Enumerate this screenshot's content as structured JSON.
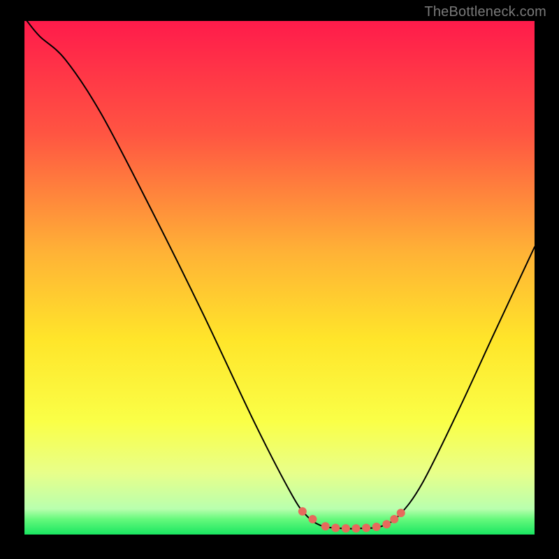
{
  "watermark": "TheBottleneck.com",
  "chart_data": {
    "type": "line",
    "title": "",
    "xlabel": "",
    "ylabel": "",
    "xlim": [
      0,
      100
    ],
    "ylim": [
      0,
      100
    ],
    "legend": false,
    "grid": false,
    "gradient_stops": [
      {
        "offset": 0.0,
        "color": "#ff1b4b"
      },
      {
        "offset": 0.22,
        "color": "#ff5542"
      },
      {
        "offset": 0.45,
        "color": "#ffb236"
      },
      {
        "offset": 0.62,
        "color": "#ffe52a"
      },
      {
        "offset": 0.78,
        "color": "#faff47"
      },
      {
        "offset": 0.88,
        "color": "#e8ff8a"
      },
      {
        "offset": 0.95,
        "color": "#b9ffae"
      },
      {
        "offset": 0.97,
        "color": "#66f97c"
      },
      {
        "offset": 1.0,
        "color": "#19e661"
      }
    ],
    "series": [
      {
        "name": "bottleneck-curve",
        "color": "#000000",
        "stroke_width": 2,
        "points": [
          {
            "x": 0.5,
            "y": 100.0
          },
          {
            "x": 3.0,
            "y": 97.0
          },
          {
            "x": 8.0,
            "y": 92.5
          },
          {
            "x": 15.0,
            "y": 82.0
          },
          {
            "x": 25.0,
            "y": 63.0
          },
          {
            "x": 35.0,
            "y": 43.0
          },
          {
            "x": 45.0,
            "y": 22.0
          },
          {
            "x": 52.0,
            "y": 8.5
          },
          {
            "x": 55.0,
            "y": 4.0
          },
          {
            "x": 58.0,
            "y": 1.8
          },
          {
            "x": 62.0,
            "y": 1.2
          },
          {
            "x": 66.0,
            "y": 1.2
          },
          {
            "x": 70.0,
            "y": 1.6
          },
          {
            "x": 73.5,
            "y": 3.8
          },
          {
            "x": 78.0,
            "y": 10.0
          },
          {
            "x": 85.0,
            "y": 24.0
          },
          {
            "x": 92.0,
            "y": 39.0
          },
          {
            "x": 100.0,
            "y": 56.0
          }
        ]
      }
    ],
    "markers": {
      "name": "optimal-zone-dots",
      "color": "#e66a5c",
      "radius": 6,
      "points": [
        {
          "x": 54.5,
          "y": 4.5
        },
        {
          "x": 56.5,
          "y": 3.0
        },
        {
          "x": 59.0,
          "y": 1.6
        },
        {
          "x": 61.0,
          "y": 1.3
        },
        {
          "x": 63.0,
          "y": 1.2
        },
        {
          "x": 65.0,
          "y": 1.2
        },
        {
          "x": 67.0,
          "y": 1.3
        },
        {
          "x": 69.0,
          "y": 1.5
        },
        {
          "x": 71.0,
          "y": 2.0
        },
        {
          "x": 72.5,
          "y": 3.0
        },
        {
          "x": 73.8,
          "y": 4.2
        }
      ]
    }
  }
}
